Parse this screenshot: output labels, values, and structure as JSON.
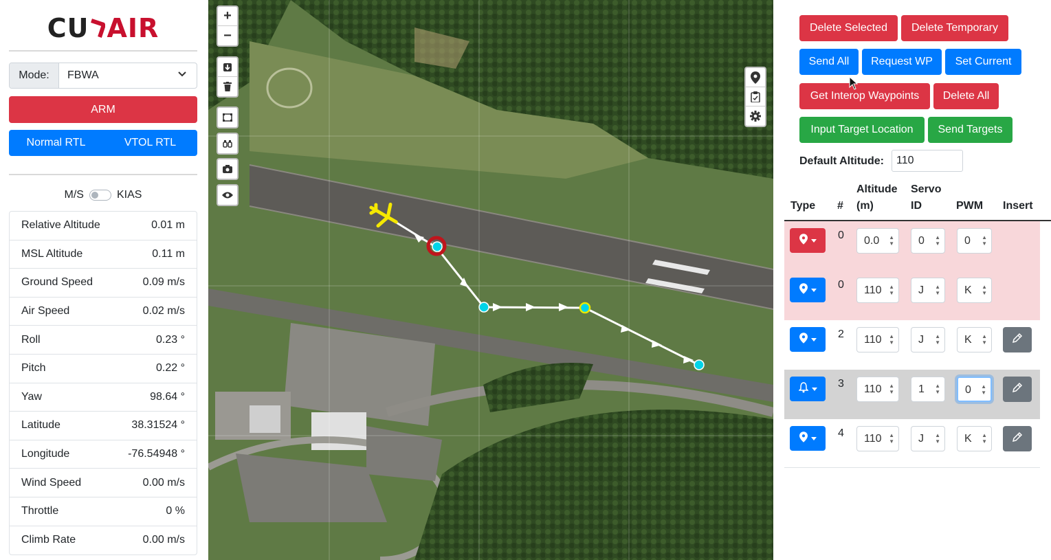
{
  "logo": {
    "left": "CU",
    "right": "AIR"
  },
  "mode": {
    "label": "Mode:",
    "value": "FBWA"
  },
  "arm_label": "ARM",
  "rtl": {
    "normal": "Normal RTL",
    "vtol": "VTOL RTL"
  },
  "units": {
    "left": "M/S",
    "right": "KIAS"
  },
  "telemetry": [
    {
      "label": "Relative Altitude",
      "value": "0.01 m"
    },
    {
      "label": "MSL Altitude",
      "value": "0.11 m"
    },
    {
      "label": "Ground Speed",
      "value": "0.09 m/s"
    },
    {
      "label": "Air Speed",
      "value": "0.02 m/s"
    },
    {
      "label": "Roll",
      "value": "0.23 °"
    },
    {
      "label": "Pitch",
      "value": "0.22 °"
    },
    {
      "label": "Yaw",
      "value": "98.64 °"
    },
    {
      "label": "Latitude",
      "value": "38.31524 °"
    },
    {
      "label": "Longitude",
      "value": "-76.54948 °"
    },
    {
      "label": "Wind Speed",
      "value": "0.00 m/s"
    },
    {
      "label": "Throttle",
      "value": "0 %"
    },
    {
      "label": "Climb Rate",
      "value": "0.00 m/s"
    }
  ],
  "map_controls": {
    "zoom_in": "+",
    "zoom_out": "−"
  },
  "buttons": {
    "delete_selected": "Delete Selected",
    "delete_temporary": "Delete Temporary",
    "send_all": "Send All",
    "request_wp": "Request WP",
    "set_current": "Set Current",
    "get_interop": "Get Interop Waypoints",
    "delete_all": "Delete All",
    "input_target": "Input Target Location",
    "send_targets": "Send Targets"
  },
  "default_altitude": {
    "label": "Default Altitude:",
    "value": "110"
  },
  "table_headers": {
    "type": "Type",
    "num": "#",
    "altitude_1": "Altitude",
    "altitude_2": "(m)",
    "servo_1": "Servo",
    "servo_2": "ID",
    "pwm": "PWM",
    "insert": "Insert"
  },
  "waypoints": [
    {
      "num": "0",
      "icon": "map-pin-icon",
      "altitude": "0.0",
      "servo": "0",
      "pwm": "0",
      "bg": "#f8d7da",
      "type_color": "#dc3545",
      "editable": false
    },
    {
      "num": "0",
      "icon": "map-pin-icon",
      "altitude": "110",
      "servo": "J",
      "pwm": "K",
      "bg": "#f8d7da",
      "type_color": "#007bff",
      "editable": false
    },
    {
      "num": "2",
      "icon": "map-pin-icon",
      "altitude": "110",
      "servo": "J",
      "pwm": "K",
      "bg": "#ffffff",
      "type_color": "#007bff",
      "editable": true
    },
    {
      "num": "3",
      "icon": "bell-icon",
      "altitude": "110",
      "servo": "1",
      "pwm": "0",
      "bg": "#d3d3d3",
      "type_color": "#007bff",
      "editable": true
    },
    {
      "num": "4",
      "icon": "map-pin-icon",
      "altitude": "110",
      "servo": "J",
      "pwm": "K",
      "bg": "#ffffff",
      "type_color": "#007bff",
      "editable": true
    }
  ],
  "colors": {
    "danger": "#dc3545",
    "primary": "#007bff",
    "success": "#28a745",
    "waypoint_marker": "#00d4e8",
    "aircraft": "#f5e800"
  }
}
